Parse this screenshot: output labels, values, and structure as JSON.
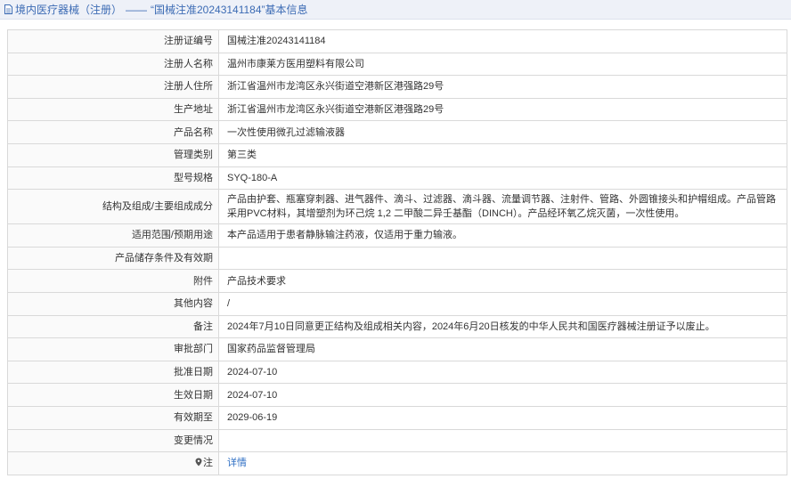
{
  "header": {
    "category": "境内医疗器械（注册）",
    "separator": "——",
    "title": "“国械注准20243141184”基本信息"
  },
  "rows": [
    {
      "label": "注册证编号",
      "value": "国械注准20243141184"
    },
    {
      "label": "注册人名称",
      "value": "温州市康莱方医用塑料有限公司"
    },
    {
      "label": "注册人住所",
      "value": "浙江省温州市龙湾区永兴街道空港新区港强路29号"
    },
    {
      "label": "生产地址",
      "value": "浙江省温州市龙湾区永兴街道空港新区港强路29号"
    },
    {
      "label": "产品名称",
      "value": "一次性使用微孔过滤输液器"
    },
    {
      "label": "管理类别",
      "value": "第三类"
    },
    {
      "label": "型号规格",
      "value": "SYQ-180-A"
    },
    {
      "label": "结构及组成/主要组成成分",
      "value": "产品由护套、瓶塞穿刺器、进气器件、滴斗、过滤器、滴斗器、流量调节器、注射件、管路、外圆锥接头和护帽组成。产品管路采用PVC材料，其增塑剂为环己烷 1,2 二甲酸二异壬基酯（DINCH）。产品经环氧乙烷灭菌，一次性使用。"
    },
    {
      "label": "适用范围/预期用途",
      "value": "本产品适用于患者静脉输注药液，仅适用于重力输液。"
    },
    {
      "label": "产品储存条件及有效期",
      "value": ""
    },
    {
      "label": "附件",
      "value": "产品技术要求"
    },
    {
      "label": "其他内容",
      "value": "/"
    },
    {
      "label": "备注",
      "value": "2024年7月10日同意更正结构及组成相关内容，2024年6月20日核发的中华人民共和国医疗器械注册证予以废止。"
    },
    {
      "label": "审批部门",
      "value": "国家药品监督管理局"
    },
    {
      "label": "批准日期",
      "value": "2024-07-10"
    },
    {
      "label": "生效日期",
      "value": "2024-07-10"
    },
    {
      "label": "有效期至",
      "value": "2029-06-19"
    },
    {
      "label": "变更情况",
      "value": ""
    }
  ],
  "note_row": {
    "label": "注",
    "link_text": "详情"
  },
  "icons": {
    "header": "document-icon",
    "note": "map-pin-icon"
  },
  "colors": {
    "header_text": "#3c6bb4",
    "link": "#2f6fc4",
    "border": "#d9d9d9"
  }
}
